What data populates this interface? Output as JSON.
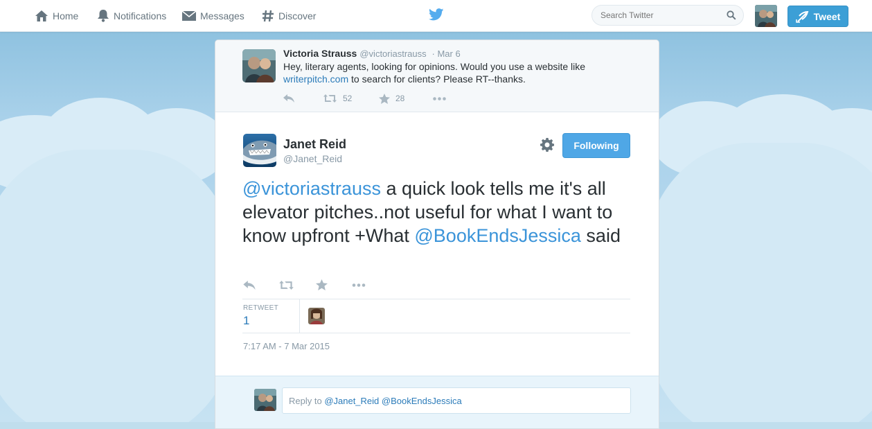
{
  "nav": {
    "home": "Home",
    "notifications": "Notifications",
    "messages": "Messages",
    "discover": "Discover",
    "search_placeholder": "Search Twitter",
    "tweet_button": "Tweet"
  },
  "parent_tweet": {
    "name": "Victoria Strauss",
    "handle": "@victoriastrauss",
    "date": "· Mar 6",
    "text_before": "Hey, literary agents, looking for opinions. Would you use a website like ",
    "link": "writerpitch.com",
    "text_after": " to search for clients? Please RT--thanks.",
    "retweets": "52",
    "favorites": "28"
  },
  "main_tweet": {
    "name": "Janet Reid",
    "handle": "@Janet_Reid",
    "follow_label": "Following",
    "mention1": "@victoriastrauss",
    "text_mid": " a quick look tells me it's all elevator pitches..not useful for what I want to know upfront +What ",
    "mention2": "@BookEndsJessica",
    "text_end": " said",
    "retweet_label": "RETWEET",
    "retweet_count": "1",
    "timestamp": "7:17 AM - 7 Mar 2015"
  },
  "reply": {
    "prefix": "Reply to ",
    "mentions": "@Janet_Reid @BookEndsJessica"
  },
  "colors": {
    "accent": "#55acee",
    "link": "#2b7bb9",
    "following_button": "#4fa7e6"
  }
}
